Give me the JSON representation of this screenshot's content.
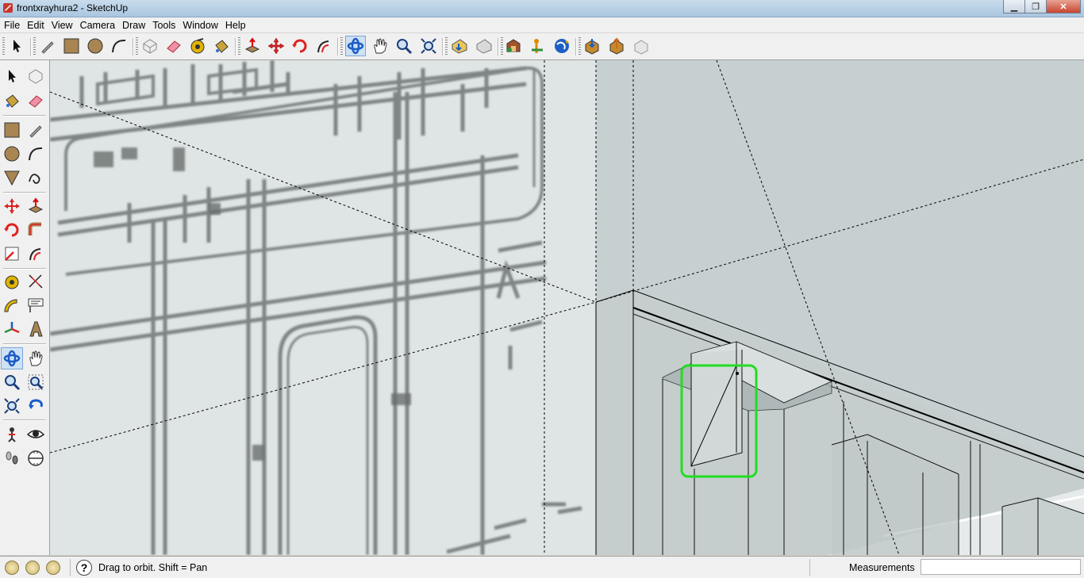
{
  "window": {
    "title": "frontxrayhura2 - SketchUp",
    "minimize_glyph": "▁",
    "maximize_glyph": "❐",
    "close_glyph": "✕"
  },
  "menu": [
    "File",
    "Edit",
    "View",
    "Camera",
    "Draw",
    "Tools",
    "Window",
    "Help"
  ],
  "toolbar_icons": [
    "select-icon",
    "pencil-icon",
    "rectangle-icon",
    "circle-icon",
    "arc-icon",
    "make-component-icon",
    "eraser-icon",
    "tape-measure-icon",
    "paint-bucket-icon",
    "push-pull-icon",
    "move-icon",
    "rotate-icon",
    "offset-icon",
    "orbit-icon",
    "pan-icon",
    "zoom-icon",
    "zoom-extents-icon",
    "previous-view-icon",
    "next-view-icon",
    "3d-warehouse-icon",
    "add-location-icon",
    "google-earth-icon",
    "get-models-icon",
    "share-model-icon",
    "share-component-icon"
  ],
  "left_toolbar_icons": [
    "select-icon",
    "make-component-icon",
    "paint-bucket-icon",
    "eraser-icon",
    "rectangle-icon",
    "line-icon",
    "circle-icon",
    "arc-icon",
    "polygon-icon",
    "freehand-icon",
    "move-icon",
    "push-pull-icon",
    "rotate-icon",
    "follow-me-icon",
    "scale-icon",
    "offset-icon",
    "tape-measure-icon",
    "dimension-icon",
    "protractor-icon",
    "text-icon",
    "axes-icon",
    "3d-text-icon",
    "orbit-icon",
    "pan-icon",
    "zoom-icon",
    "zoom-window-icon",
    "zoom-extents-icon",
    "previous-view-icon",
    "position-camera-icon",
    "look-around-icon",
    "walk-icon",
    "section-plane-icon"
  ],
  "status": {
    "hint": "Drag to orbit.  Shift = Pan",
    "measurements_label": "Measurements",
    "measurements_value": "",
    "help_glyph": "?"
  },
  "colors": {
    "selection_highlight": "#22dd22",
    "viewport_bg": "#c8d2d2",
    "blueprint_bg": "#dfe4e5"
  }
}
